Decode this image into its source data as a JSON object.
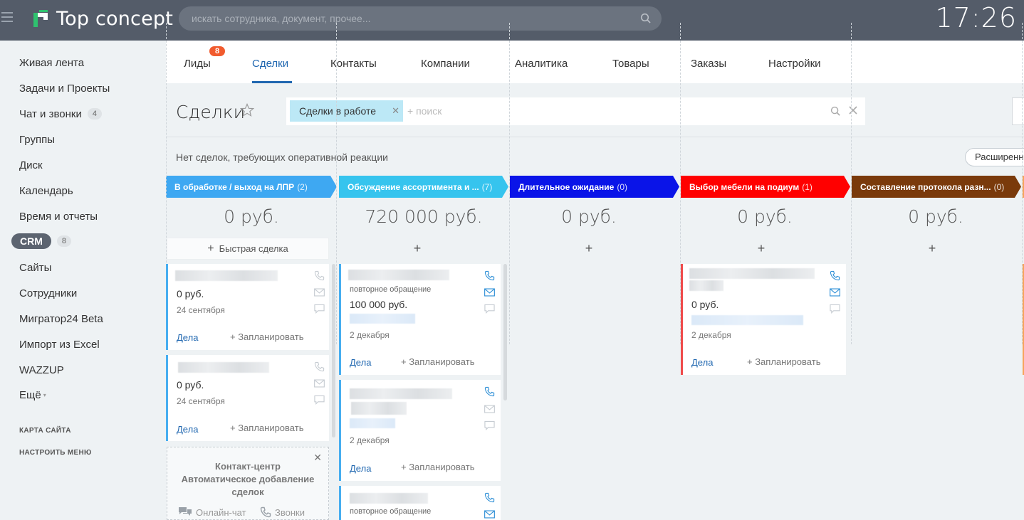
{
  "header": {
    "logo_text": "Top concept",
    "search_placeholder": "искать сотрудника, документ, прочее...",
    "clock": "17:26"
  },
  "sidebar": {
    "items": [
      {
        "label": "Живая лента"
      },
      {
        "label": "Задачи и Проекты"
      },
      {
        "label": "Чат и звонки",
        "count": "4"
      },
      {
        "label": "Группы"
      },
      {
        "label": "Диск"
      },
      {
        "label": "Календарь"
      },
      {
        "label": "Время и отчеты"
      },
      {
        "label": "CRM",
        "count": "8"
      },
      {
        "label": "Сайты"
      },
      {
        "label": "Сотрудники"
      },
      {
        "label": "Мигратор24 Beta"
      },
      {
        "label": "Импорт из Excel"
      },
      {
        "label": "WAZZUP"
      },
      {
        "label": "Ещё"
      }
    ],
    "sitemap": "КАРТА САЙТА",
    "configure_menu": "НАСТРОИТЬ МЕНЮ"
  },
  "tabs": {
    "items": [
      "Лиды",
      "Сделки",
      "Контакты",
      "Компании",
      "Аналитика",
      "Товары",
      "Заказы",
      "Настройки"
    ],
    "leads_badge": "8",
    "active": "Сделки"
  },
  "page": {
    "title": "Сделки",
    "filter_chip": "Сделки в работе",
    "filter_placeholder": "+ поиск",
    "no_deals_text": "Нет сделок, требующих оперативной реакции",
    "extended_button": "Расширенный"
  },
  "colors": {
    "stage1": "#3ea8f2",
    "stage2": "#36c4ee",
    "stage3": "#0a14e8",
    "stage4": "#ff0000",
    "stage5": "#7a3a0b",
    "accent": "#2067b0"
  },
  "kanban": {
    "quick_deal": "Быстрая сделка",
    "add": "+",
    "actions_label": "Дела",
    "plan_label": "+ Запланировать",
    "columns": [
      {
        "title": "В обработке / выход на ЛПР",
        "count": "(2)",
        "sum": "0 руб."
      },
      {
        "title": "Обсуждение ассортимента и ...",
        "count": "(7)",
        "sum": "720 000 руб."
      },
      {
        "title": "Длительное ожидание",
        "count": "(0)",
        "sum": "0 руб."
      },
      {
        "title": "Выбор мебели на подиум",
        "count": "(1)",
        "sum": "0 руб."
      },
      {
        "title": "Составление протокола разн...",
        "count": "(0)",
        "sum": "0 руб."
      }
    ],
    "cards": {
      "c1a": {
        "amount": "0 руб.",
        "date": "24 сентября"
      },
      "c1b": {
        "amount": "0 руб.",
        "date": "24 сентября"
      },
      "c2a": {
        "tag": "повторное обращение",
        "amount": "100 000 руб.",
        "date": "2 декабря"
      },
      "c2b": {
        "date": "2 декабря"
      },
      "c2c": {
        "tag": "повторное обращение"
      },
      "c4a": {
        "amount": "0 руб.",
        "date": "2 декабря"
      }
    }
  },
  "contact_center": {
    "title_line1": "Контакт-центр",
    "title_line2": "Автоматическое добавление",
    "title_line3": "сделок",
    "online_chat": "Онлайн-чат",
    "calls": "Звонки"
  }
}
